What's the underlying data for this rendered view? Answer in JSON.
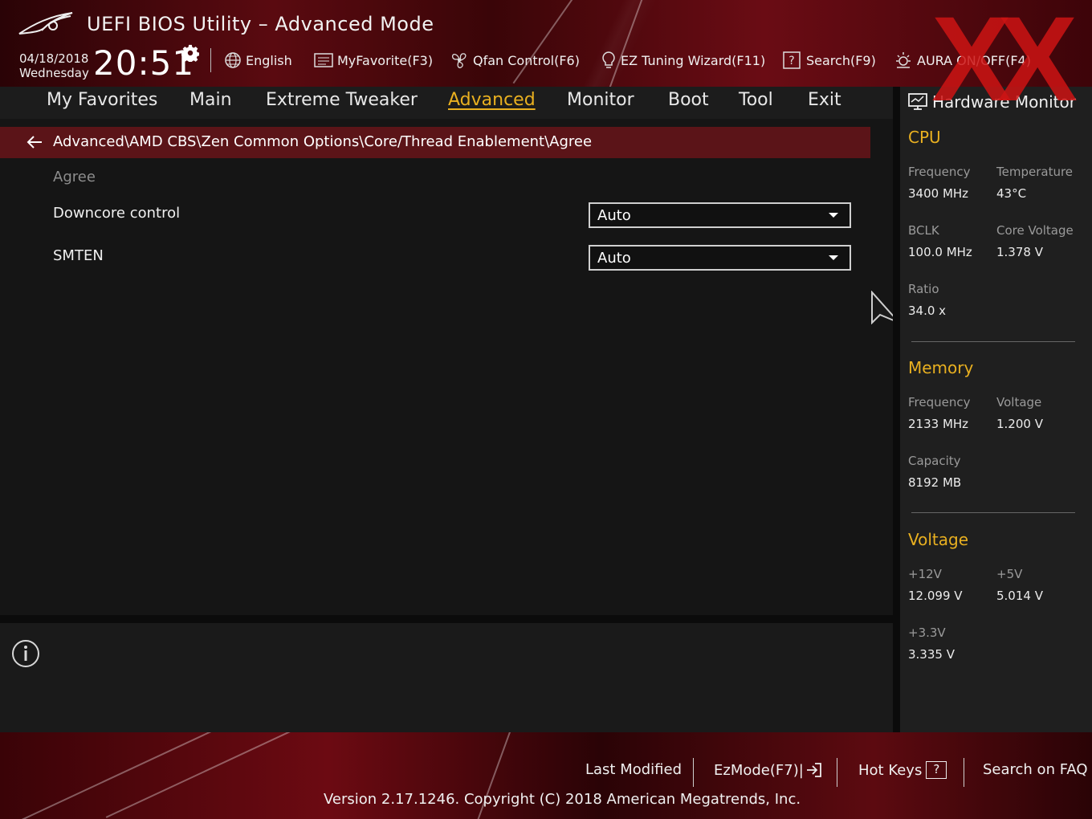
{
  "header": {
    "title": "UEFI BIOS Utility – Advanced Mode",
    "date": "04/18/2018",
    "day": "Wednesday",
    "time": "20:51",
    "toolbar": [
      {
        "label": "English",
        "icon": "globe-icon"
      },
      {
        "label": "MyFavorite(F3)",
        "icon": "favorite-list-icon"
      },
      {
        "label": "Qfan Control(F6)",
        "icon": "fan-icon"
      },
      {
        "label": "EZ Tuning Wizard(F11)",
        "icon": "bulb-icon"
      },
      {
        "label": "Search(F9)",
        "icon": "help-box-icon"
      },
      {
        "label": "AURA ON/OFF(F4)",
        "icon": "aura-icon"
      }
    ],
    "watermark": "XX"
  },
  "nav": {
    "tabs": [
      "My Favorites",
      "Main",
      "Extreme Tweaker",
      "Advanced",
      "Monitor",
      "Boot",
      "Tool",
      "Exit"
    ],
    "active": "Advanced"
  },
  "main": {
    "breadcrumb": "Advanced\\AMD CBS\\Zen Common Options\\Core/Thread Enablement\\Agree",
    "subheading": "Agree",
    "settings": [
      {
        "label": "Downcore control",
        "value": "Auto"
      },
      {
        "label": "SMTEN",
        "value": "Auto"
      }
    ]
  },
  "hw_monitor": {
    "title": "Hardware Monitor",
    "cpu": {
      "heading": "CPU",
      "freq_label": "Frequency",
      "freq": "3400 MHz",
      "temp_label": "Temperature",
      "temp": "43°C",
      "bclk_label": "BCLK",
      "bclk": "100.0 MHz",
      "vcore_label": "Core Voltage",
      "vcore": "1.378 V",
      "ratio_label": "Ratio",
      "ratio": "34.0 x"
    },
    "memory": {
      "heading": "Memory",
      "freq_label": "Frequency",
      "freq": "2133 MHz",
      "volt_label": "Voltage",
      "volt": "1.200 V",
      "cap_label": "Capacity",
      "cap": "8192 MB"
    },
    "voltage": {
      "heading": "Voltage",
      "v12_label": "+12V",
      "v12": "12.099 V",
      "v5_label": "+5V",
      "v5": "5.014 V",
      "v33_label": "+3.3V",
      "v33": "3.335 V"
    }
  },
  "footer": {
    "last_modified": "Last Modified",
    "ezmode": "EzMode(F7)|",
    "hotkeys": "Hot Keys",
    "hotkeys_key": "?",
    "faq": "Search on FAQ",
    "version": "Version 2.17.1246. Copyright (C) 2018 American Megatrends, Inc."
  },
  "colors": {
    "accent": "#e9b020",
    "breadcrumb_bg": "#5b1418",
    "header_red": "#6a0c14"
  }
}
